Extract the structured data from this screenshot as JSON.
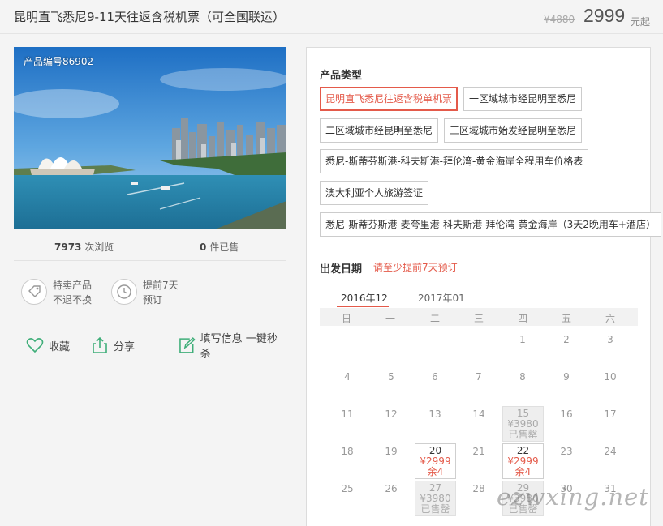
{
  "header": {
    "title": "昆明直飞悉尼9-11天往返含税机票（可全国联运）",
    "old_price": "¥4880",
    "price": "2999",
    "price_suffix": "元起"
  },
  "photo": {
    "product_code": "产品编号86902"
  },
  "stats": {
    "views_count": "7973",
    "views_label": "次浏览",
    "sold_count": "0",
    "sold_label": "件已售"
  },
  "features": [
    {
      "icon": "tag-icon",
      "line1": "特卖产品",
      "line2": "不退不换"
    },
    {
      "icon": "clock-icon",
      "line1": "提前7天",
      "line2": "预订"
    }
  ],
  "actions": {
    "favorite": "收藏",
    "share": "分享",
    "fill_info": "填写信息 一键秒杀"
  },
  "product_types": {
    "label": "产品类型",
    "options": [
      "昆明直飞悉尼往返含税单机票",
      "一区域城市经昆明至悉尼",
      "二区域城市经昆明至悉尼",
      "三区域城市始发经昆明至悉尼",
      "悉尼-斯蒂芬斯港-科夫斯港-拜伦湾-黄金海岸全程用车价格表",
      "澳大利亚个人旅游签证",
      "悉尼-斯蒂芬斯港-麦夸里港-科夫斯港-拜伦湾-黄金海岸（3天2晚用车+酒店）"
    ],
    "selected_index": 0
  },
  "departure": {
    "label": "出发日期",
    "notice": "请至少提前7天预订"
  },
  "calendar": {
    "months": [
      "2016年12",
      "2017年01"
    ],
    "active_month": 0,
    "weekdays": [
      "日",
      "一",
      "二",
      "三",
      "四",
      "五",
      "六"
    ],
    "days": [
      "1",
      "2",
      "3",
      "4",
      "5",
      "6",
      "7",
      "8",
      "9",
      "10",
      "11",
      "12",
      "13",
      "14",
      "16",
      "17",
      "18",
      "19",
      "21",
      "23",
      "24",
      "25",
      "26",
      "28",
      "30",
      "31"
    ],
    "cells": {
      "d15": {
        "day": "15",
        "price": "¥3980",
        "status": "已售罄"
      },
      "d20": {
        "day": "20",
        "price": "¥2999",
        "status": "余4"
      },
      "d22": {
        "day": "22",
        "price": "¥2999",
        "status": "余4"
      },
      "d27": {
        "day": "27",
        "price": "¥3980",
        "status": "已售罄"
      },
      "d29": {
        "day": "29",
        "price": "¥3980",
        "status": "已售罄"
      }
    }
  },
  "watermark": "ezwxing.net",
  "colors": {
    "accent": "#e45a4a",
    "price": "#555555",
    "sold_out_bg": "#eeeeee"
  }
}
